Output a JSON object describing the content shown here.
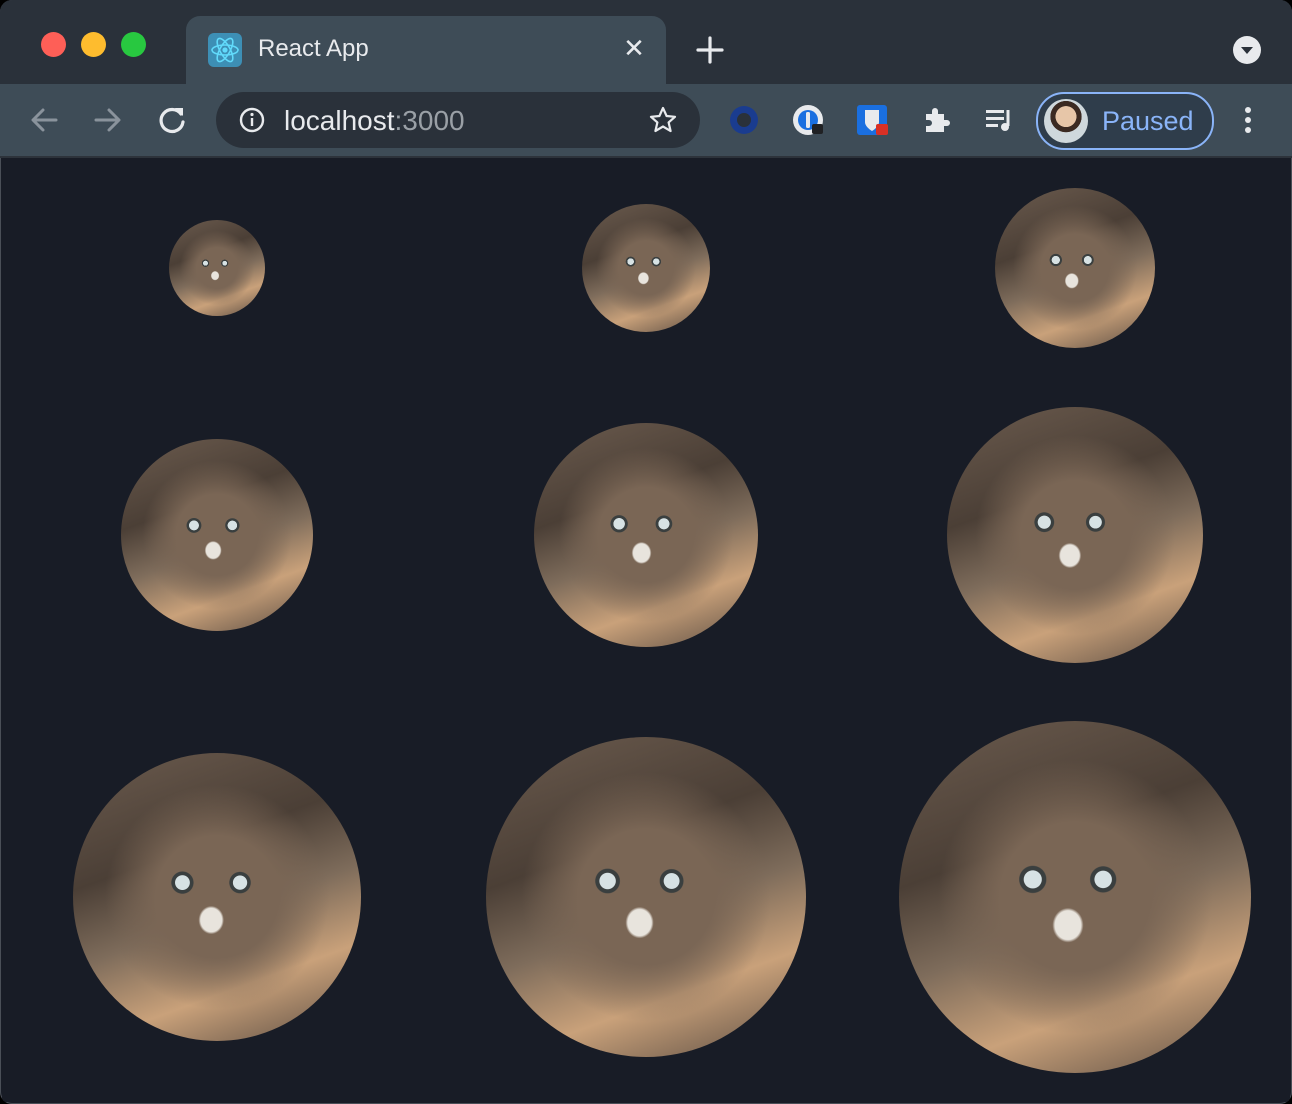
{
  "window": {
    "tab": {
      "title": "React App",
      "close_label": "✕"
    },
    "traffic_lights": [
      "close",
      "minimize",
      "zoom"
    ]
  },
  "toolbar": {
    "url_host": "localhost",
    "url_port": ":3000",
    "profile_label": "Paused",
    "extensions": [
      "opera-icon",
      "onepassword-icon",
      "bitwarden-icon",
      "puzzle-icon",
      "media-control-icon"
    ]
  },
  "icons": {
    "back": "arrow-left-icon",
    "forward": "arrow-right-icon",
    "reload": "reload-icon",
    "info": "info-icon",
    "star": "star-icon",
    "menu": "kebab-menu-icon"
  },
  "colors": {
    "tabstrip": "#2a313a",
    "toolbar": "#3e4c57",
    "content_bg": "#181c26",
    "accent": "#8ab4f8"
  },
  "content": {
    "images": [
      {
        "alt": "kitten"
      },
      {
        "alt": "kitten"
      },
      {
        "alt": "kitten"
      },
      {
        "alt": "kitten"
      },
      {
        "alt": "kitten"
      },
      {
        "alt": "kitten"
      },
      {
        "alt": "kitten"
      },
      {
        "alt": "kitten"
      },
      {
        "alt": "kitten"
      }
    ]
  }
}
